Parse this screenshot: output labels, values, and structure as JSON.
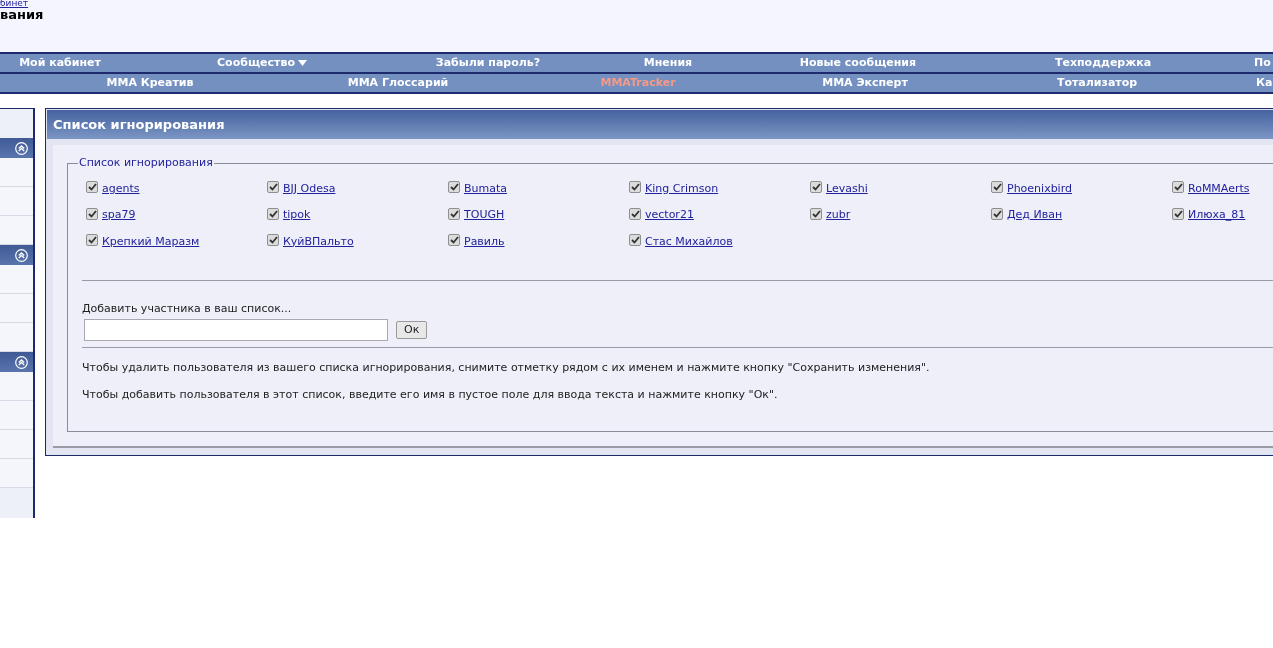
{
  "top_link": "бинет",
  "page_title": "вания",
  "nav_rows": [
    [
      {
        "label": "Мой кабинет",
        "selected": false,
        "has_menu": false
      },
      {
        "label": "Сообщество",
        "selected": false,
        "has_menu": true
      },
      {
        "label": "Забыли пароль?",
        "selected": false,
        "has_menu": false
      },
      {
        "label": "Мнения",
        "selected": false,
        "has_menu": false
      },
      {
        "label": "Новые сообщения",
        "selected": false,
        "has_menu": false
      },
      {
        "label": "Техподдержка",
        "selected": false,
        "has_menu": false
      },
      {
        "label": "По",
        "selected": false,
        "has_menu": false
      }
    ],
    [
      {
        "label": "MMA Креатив",
        "selected": false
      },
      {
        "label": "MMA Глоссарий",
        "selected": false
      },
      {
        "label": "MMATracker",
        "selected": true
      },
      {
        "label": "MMA Эксперт",
        "selected": false
      },
      {
        "label": "Тотализатор",
        "selected": false
      },
      {
        "label": "Ка",
        "selected": false
      }
    ]
  ],
  "panel": {
    "title": "Список игнорирования",
    "legend": "Список игнорирования",
    "users": [
      {
        "name": "agents",
        "checked": true
      },
      {
        "name": "BJJ Odesa",
        "checked": true
      },
      {
        "name": "Bumata",
        "checked": true
      },
      {
        "name": "King Crimson",
        "checked": true
      },
      {
        "name": "Levashi",
        "checked": true
      },
      {
        "name": "Phoenixbird",
        "checked": true
      },
      {
        "name": "RoMMAerts",
        "checked": true
      },
      {
        "name": "spa79",
        "checked": true
      },
      {
        "name": "tipok",
        "checked": true
      },
      {
        "name": "TOUGH",
        "checked": true
      },
      {
        "name": "vector21",
        "checked": true
      },
      {
        "name": "zubr",
        "checked": true
      },
      {
        "name": "Дед Иван",
        "checked": true
      },
      {
        "name": "Илюха_81",
        "checked": true
      },
      {
        "name": "Крепкий Маразм",
        "checked": true
      },
      {
        "name": "КуйВПальто",
        "checked": true
      },
      {
        "name": "Равиль",
        "checked": true
      },
      {
        "name": "Стас Михайлов",
        "checked": true
      }
    ],
    "add_label": "Добавить участника в ваш список...",
    "add_button": "Ок",
    "notes": [
      "Чтобы удалить пользователя из вашего списка игнорирования, снимите отметку рядом с их именем и нажмите кнопку \"Сохранить изменения\".",
      "Чтобы добавить пользователя в этот список, введите его имя в пустое поле для ввода текста и нажмите кнопку \"Ок\"."
    ]
  }
}
